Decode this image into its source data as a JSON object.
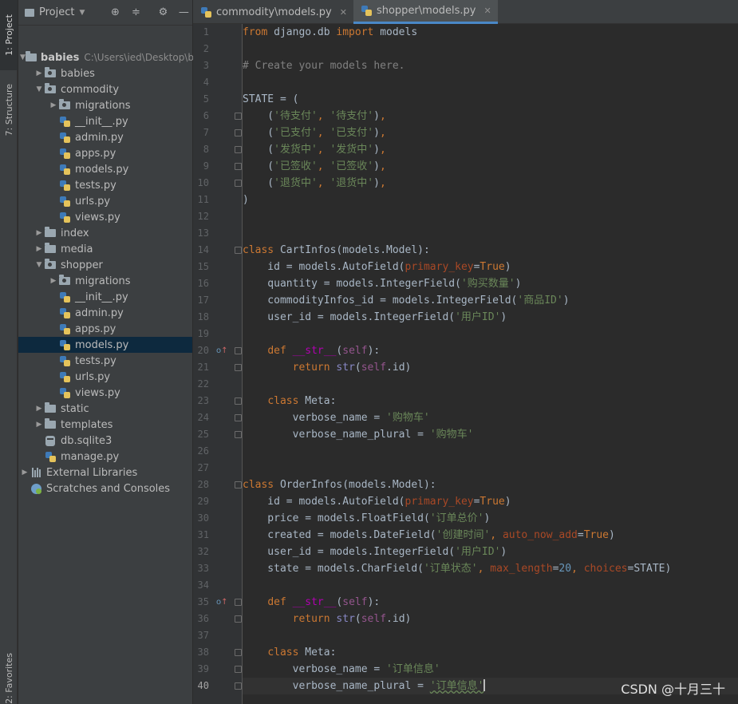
{
  "left_strip": {
    "project_tab": "1: Project",
    "structure_tab": "7: Structure",
    "favorites_tab": "2: Favorites"
  },
  "project_panel": {
    "view_selector": "Project",
    "tree": [
      {
        "label": "babies",
        "path": "C:\\Users\\ied\\Desktop\\b",
        "depth": 0,
        "arrow": "down",
        "icon": "folder-icon",
        "bold": true
      },
      {
        "label": "babies",
        "depth": 1,
        "arrow": "right",
        "icon": "package-folder-icon"
      },
      {
        "label": "commodity",
        "depth": 1,
        "arrow": "down",
        "icon": "package-folder-icon"
      },
      {
        "label": "migrations",
        "depth": 2,
        "arrow": "right",
        "icon": "package-folder-icon"
      },
      {
        "label": "__init__.py",
        "depth": 2,
        "arrow": "none",
        "icon": "python-file-icon"
      },
      {
        "label": "admin.py",
        "depth": 2,
        "arrow": "none",
        "icon": "python-file-icon"
      },
      {
        "label": "apps.py",
        "depth": 2,
        "arrow": "none",
        "icon": "python-file-icon"
      },
      {
        "label": "models.py",
        "depth": 2,
        "arrow": "none",
        "icon": "python-file-icon"
      },
      {
        "label": "tests.py",
        "depth": 2,
        "arrow": "none",
        "icon": "python-file-icon"
      },
      {
        "label": "urls.py",
        "depth": 2,
        "arrow": "none",
        "icon": "python-file-icon"
      },
      {
        "label": "views.py",
        "depth": 2,
        "arrow": "none",
        "icon": "python-file-icon"
      },
      {
        "label": "index",
        "depth": 1,
        "arrow": "right",
        "icon": "folder-icon"
      },
      {
        "label": "media",
        "depth": 1,
        "arrow": "right",
        "icon": "folder-icon"
      },
      {
        "label": "shopper",
        "depth": 1,
        "arrow": "down",
        "icon": "package-folder-icon"
      },
      {
        "label": "migrations",
        "depth": 2,
        "arrow": "right",
        "icon": "package-folder-icon"
      },
      {
        "label": "__init__.py",
        "depth": 2,
        "arrow": "none",
        "icon": "python-file-icon"
      },
      {
        "label": "admin.py",
        "depth": 2,
        "arrow": "none",
        "icon": "python-file-icon"
      },
      {
        "label": "apps.py",
        "depth": 2,
        "arrow": "none",
        "icon": "python-file-icon"
      },
      {
        "label": "models.py",
        "depth": 2,
        "arrow": "none",
        "icon": "python-file-icon",
        "selected": true
      },
      {
        "label": "tests.py",
        "depth": 2,
        "arrow": "none",
        "icon": "python-file-icon"
      },
      {
        "label": "urls.py",
        "depth": 2,
        "arrow": "none",
        "icon": "python-file-icon"
      },
      {
        "label": "views.py",
        "depth": 2,
        "arrow": "none",
        "icon": "python-file-icon"
      },
      {
        "label": "static",
        "depth": 1,
        "arrow": "right",
        "icon": "folder-icon"
      },
      {
        "label": "templates",
        "depth": 1,
        "arrow": "right",
        "icon": "folder-icon"
      },
      {
        "label": "db.sqlite3",
        "depth": 1,
        "arrow": "none",
        "icon": "database-icon"
      },
      {
        "label": "manage.py",
        "depth": 1,
        "arrow": "none",
        "icon": "python-file-icon"
      },
      {
        "label": "External Libraries",
        "depth": 0,
        "arrow": "right",
        "icon": "libraries-icon"
      },
      {
        "label": "Scratches and Consoles",
        "depth": 0,
        "arrow": "none",
        "icon": "scratches-icon"
      }
    ]
  },
  "editor": {
    "tabs": [
      {
        "label": "commodity\\models.py",
        "active": false
      },
      {
        "label": "shopper\\models.py",
        "active": true
      }
    ],
    "current_line": 40,
    "lines": [
      [
        [
          "k",
          "from"
        ],
        [
          "p",
          " django.db "
        ],
        [
          "k",
          "import"
        ],
        [
          "p",
          " models"
        ]
      ],
      [],
      [
        [
          "c",
          "# Create your models here."
        ]
      ],
      [],
      [
        [
          "p",
          "STATE = ("
        ]
      ],
      [
        [
          "p",
          "    ("
        ],
        [
          "s",
          "'待支付'"
        ],
        [
          "k",
          ", "
        ],
        [
          "s",
          "'待支付'"
        ],
        [
          "p",
          ")"
        ],
        [
          "k",
          ","
        ]
      ],
      [
        [
          "p",
          "    ("
        ],
        [
          "s",
          "'已支付'"
        ],
        [
          "k",
          ", "
        ],
        [
          "s",
          "'已支付'"
        ],
        [
          "p",
          ")"
        ],
        [
          "k",
          ","
        ]
      ],
      [
        [
          "p",
          "    ("
        ],
        [
          "s",
          "'发货中'"
        ],
        [
          "k",
          ", "
        ],
        [
          "s",
          "'发货中'"
        ],
        [
          "p",
          ")"
        ],
        [
          "k",
          ","
        ]
      ],
      [
        [
          "p",
          "    ("
        ],
        [
          "s",
          "'已签收'"
        ],
        [
          "k",
          ", "
        ],
        [
          "s",
          "'已签收'"
        ],
        [
          "p",
          ")"
        ],
        [
          "k",
          ","
        ]
      ],
      [
        [
          "p",
          "    ("
        ],
        [
          "s",
          "'退货中'"
        ],
        [
          "k",
          ", "
        ],
        [
          "s",
          "'退货中'"
        ],
        [
          "p",
          ")"
        ],
        [
          "k",
          ","
        ]
      ],
      [
        [
          "p",
          ")"
        ]
      ],
      [],
      [],
      [
        [
          "k",
          "class "
        ],
        [
          "p",
          "CartInfos(models.Model):"
        ]
      ],
      [
        [
          "p",
          "    id = models.AutoField("
        ],
        [
          "pa",
          "primary_key"
        ],
        [
          "p",
          "="
        ],
        [
          "k",
          "True"
        ],
        [
          "p",
          ")"
        ]
      ],
      [
        [
          "p",
          "    quantity = models.IntegerField("
        ],
        [
          "s",
          "'购买数量'"
        ],
        [
          "p",
          ")"
        ]
      ],
      [
        [
          "p",
          "    commodityInfos_id = models.IntegerField("
        ],
        [
          "s",
          "'商品ID'"
        ],
        [
          "p",
          ")"
        ]
      ],
      [
        [
          "p",
          "    user_id = models.IntegerField("
        ],
        [
          "s",
          "'用户ID'"
        ],
        [
          "p",
          ")"
        ]
      ],
      [],
      [
        [
          "p",
          "    "
        ],
        [
          "k",
          "def "
        ],
        [
          "dn",
          "__str__"
        ],
        [
          "p",
          "("
        ],
        [
          "sf",
          "self"
        ],
        [
          "p",
          "):"
        ]
      ],
      [
        [
          "p",
          "        "
        ],
        [
          "k",
          "return "
        ],
        [
          "bi",
          "str"
        ],
        [
          "p",
          "("
        ],
        [
          "sf",
          "self"
        ],
        [
          "p",
          ".id)"
        ]
      ],
      [],
      [
        [
          "p",
          "    "
        ],
        [
          "k",
          "class "
        ],
        [
          "p",
          "Meta:"
        ]
      ],
      [
        [
          "p",
          "        verbose_name = "
        ],
        [
          "s",
          "'购物车'"
        ]
      ],
      [
        [
          "p",
          "        verbose_name_plural = "
        ],
        [
          "s",
          "'购物车'"
        ]
      ],
      [],
      [],
      [
        [
          "k",
          "class "
        ],
        [
          "p",
          "OrderInfos(models.Model):"
        ]
      ],
      [
        [
          "p",
          "    id = models.AutoField("
        ],
        [
          "pa",
          "primary_key"
        ],
        [
          "p",
          "="
        ],
        [
          "k",
          "True"
        ],
        [
          "p",
          ")"
        ]
      ],
      [
        [
          "p",
          "    price = models.FloatField("
        ],
        [
          "s",
          "'订单总价'"
        ],
        [
          "p",
          ")"
        ]
      ],
      [
        [
          "p",
          "    created = models.DateField("
        ],
        [
          "s",
          "'创建时间'"
        ],
        [
          "k",
          ", "
        ],
        [
          "pa",
          "auto_now_add"
        ],
        [
          "p",
          "="
        ],
        [
          "k",
          "True"
        ],
        [
          "p",
          ")"
        ]
      ],
      [
        [
          "p",
          "    user_id = models.IntegerField("
        ],
        [
          "s",
          "'用户ID'"
        ],
        [
          "p",
          ")"
        ]
      ],
      [
        [
          "p",
          "    state = models.CharField("
        ],
        [
          "s",
          "'订单状态'"
        ],
        [
          "k",
          ", "
        ],
        [
          "pa",
          "max_length"
        ],
        [
          "p",
          "="
        ],
        [
          "n",
          "20"
        ],
        [
          "k",
          ", "
        ],
        [
          "pa",
          "choices"
        ],
        [
          "p",
          "=STATE)"
        ]
      ],
      [],
      [
        [
          "p",
          "    "
        ],
        [
          "k",
          "def "
        ],
        [
          "dn",
          "__str__"
        ],
        [
          "p",
          "("
        ],
        [
          "sf",
          "self"
        ],
        [
          "p",
          "):"
        ]
      ],
      [
        [
          "p",
          "        "
        ],
        [
          "k",
          "return "
        ],
        [
          "bi",
          "str"
        ],
        [
          "p",
          "("
        ],
        [
          "sf",
          "self"
        ],
        [
          "p",
          ".id)"
        ]
      ],
      [],
      [
        [
          "p",
          "    "
        ],
        [
          "k",
          "class "
        ],
        [
          "p",
          "Meta:"
        ]
      ],
      [
        [
          "p",
          "        verbose_name = "
        ],
        [
          "s",
          "'订单信息'"
        ]
      ],
      [
        [
          "p",
          "        verbose_name_plural = "
        ],
        [
          "sul",
          "'订单信息'"
        ],
        [
          "caret",
          ""
        ]
      ]
    ]
  },
  "watermark": "CSDN @十月三十"
}
